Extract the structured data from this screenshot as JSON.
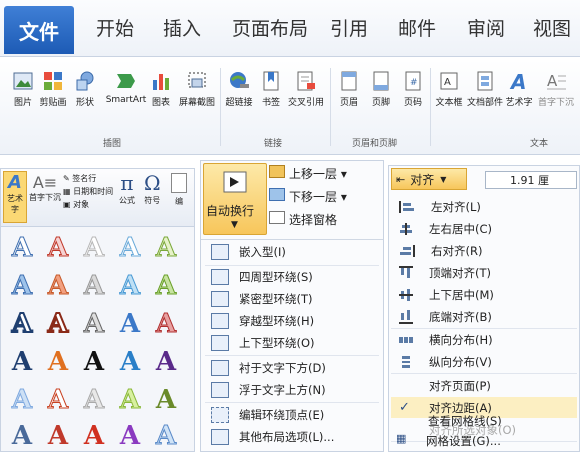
{
  "tabs": [
    "文件",
    "开始",
    "插入",
    "页面布局",
    "引用",
    "邮件",
    "审阅",
    "视图"
  ],
  "ribbon": {
    "buttons": [
      "图片",
      "剪贴画",
      "形状",
      "SmartArt",
      "图表",
      "屏幕截图",
      "超链接",
      "书签",
      "交叉引用",
      "页眉",
      "页脚",
      "页码",
      "文本框",
      "文档部件",
      "艺术字",
      "首字下沉"
    ],
    "groups": [
      "插图",
      "链接",
      "页眉和页脚",
      "文本"
    ]
  },
  "wordart_panel": {
    "strip": {
      "wordart": "艺术字",
      "dropcap": "首字下沉",
      "signature": "签名行",
      "datetime": "日期和时间",
      "object": "对象",
      "equation": "公式",
      "symbol": "符号",
      "edit": "编"
    },
    "glyph": "A"
  },
  "wrap_menu": {
    "button": "自动换行",
    "move_up": "上移一层",
    "move_down": "下移一层",
    "selection_pane": "选择窗格",
    "items": [
      "嵌入型(I)",
      "四周型环绕(S)",
      "紧密型环绕(T)",
      "穿越型环绕(H)",
      "上下型环绕(O)",
      "衬于文字下方(D)",
      "浮于文字上方(N)",
      "编辑环绕顶点(E)",
      "其他布局选项(L)..."
    ]
  },
  "align_menu": {
    "button": "对齐",
    "size_value": "1.91 厘",
    "items": [
      "左对齐(L)",
      "左右居中(C)",
      "右对齐(R)",
      "顶端对齐(T)",
      "上下居中(M)",
      "底端对齐(B)",
      "横向分布(H)",
      "纵向分布(V)",
      "对齐页面(P)",
      "对齐边距(A)",
      "对齐所选对象(O)",
      "查看网格线(S)",
      "网格设置(G)..."
    ]
  },
  "colors": {
    "file_tab": "#2b6cc4",
    "highlight": "#f7c65b"
  }
}
